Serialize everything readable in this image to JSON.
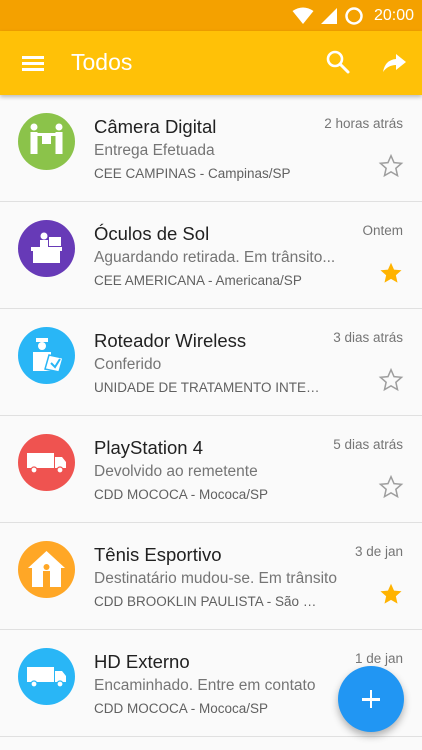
{
  "statusbar": {
    "time": "20:00",
    "icons": [
      "wifi-icon",
      "signal-icon",
      "sync-icon"
    ]
  },
  "appbar": {
    "title": "Todos",
    "actions": [
      "menu-icon",
      "search-icon",
      "share-icon"
    ]
  },
  "colors": {
    "appbar": "#ffc107",
    "statusbar": "#f4a100",
    "fab": "#2196f3",
    "star_filled": "#ffb300"
  },
  "items": [
    {
      "name": "Câmera Digital",
      "status": "Entrega Efetuada",
      "location": "CEE CAMPINAS - Campinas/SP",
      "time": "2 horas atrás",
      "starred": false,
      "icon": "delivery-handover-icon",
      "color": "#8bc34a"
    },
    {
      "name": "Óculos de Sol",
      "status": "Aguardando retirada. Em trânsito...",
      "location": "CEE AMERICANA - Americana/SP",
      "time": "Ontem",
      "starred": true,
      "icon": "post-office-counter-icon",
      "color": "#673ab7"
    },
    {
      "name": "Roteador Wireless",
      "status": "Conferido",
      "location": "UNIDADE DE TRATAMENTO INTERNACIONAL",
      "time": "3 dias atrás",
      "starred": false,
      "icon": "inspector-icon",
      "color": "#29b6f6"
    },
    {
      "name": "PlayStation 4",
      "status": "Devolvido ao remetente",
      "location": "CDD MOCOCA - Mococa/SP",
      "time": "5 dias atrás",
      "starred": false,
      "icon": "truck-icon",
      "color": "#ef5350"
    },
    {
      "name": "Tênis Esportivo",
      "status": "Destinatário mudou-se. Em trânsito",
      "location": "CDD BROOKLIN PAULISTA - São Paulo/SP",
      "time": "3 de jan",
      "starred": true,
      "icon": "house-icon",
      "color": "#ffa726"
    },
    {
      "name": "HD Externo",
      "status": "Encaminhado. Entre em contato",
      "location": "CDD MOCOCA - Mococa/SP",
      "time": "1 de jan",
      "starred": false,
      "icon": "truck-icon",
      "color": "#29b6f6"
    }
  ],
  "fab": {
    "icon": "plus-icon",
    "label": "+"
  }
}
